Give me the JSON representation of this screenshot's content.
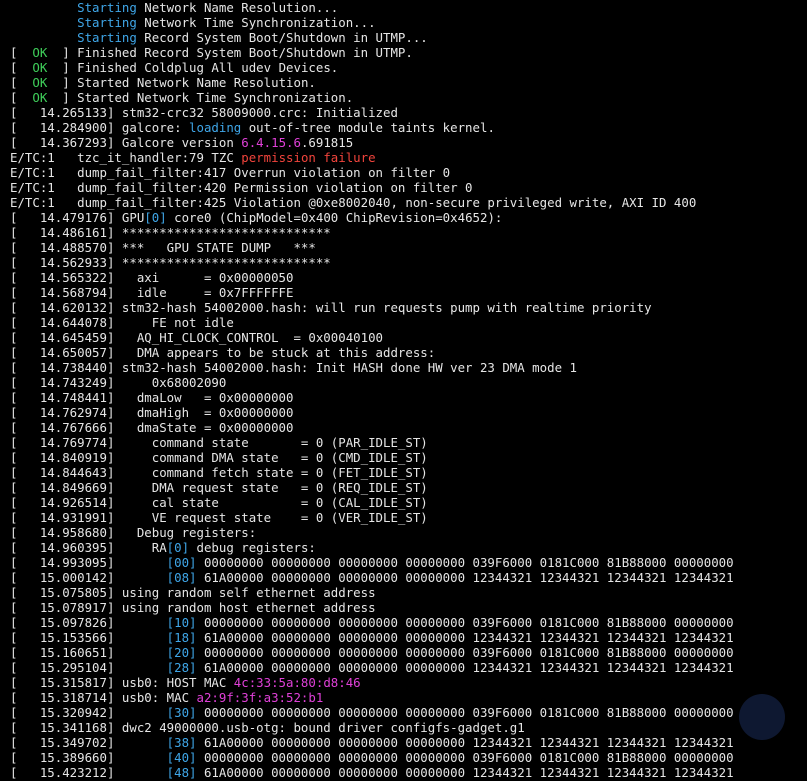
{
  "colors": {
    "background": "#000000",
    "default": "#e6e6e6",
    "cyan": "#3fa6e8",
    "green": "#3fcf5a",
    "magenta": "#e040d8",
    "red": "#f2443c"
  },
  "lines": [
    [
      [
        "default",
        "         "
      ],
      [
        "cyan",
        "Starting"
      ],
      [
        "default",
        " Network Name Resolution..."
      ]
    ],
    [
      [
        "default",
        "         "
      ],
      [
        "cyan",
        "Starting"
      ],
      [
        "default",
        " Network Time Synchronization..."
      ]
    ],
    [
      [
        "default",
        "         "
      ],
      [
        "cyan",
        "Starting"
      ],
      [
        "default",
        " Record System Boot/Shutdown in UTMP..."
      ]
    ],
    [
      [
        "default",
        "[  "
      ],
      [
        "green",
        "OK"
      ],
      [
        "default",
        "  ] Finished Record System Boot/Shutdown in UTMP."
      ]
    ],
    [
      [
        "default",
        "[  "
      ],
      [
        "green",
        "OK"
      ],
      [
        "default",
        "  ] Finished Coldplug All udev Devices."
      ]
    ],
    [
      [
        "default",
        "[  "
      ],
      [
        "green",
        "OK"
      ],
      [
        "default",
        "  ] Started Network Name Resolution."
      ]
    ],
    [
      [
        "default",
        "[  "
      ],
      [
        "green",
        "OK"
      ],
      [
        "default",
        "  ] Started Network Time Synchronization."
      ]
    ],
    [
      [
        "default",
        "[   14.265133] stm32-crc32 58009000.crc: Initialized"
      ]
    ],
    [
      [
        "default",
        "[   14.284900] galcore: "
      ],
      [
        "cyan",
        "loading"
      ],
      [
        "default",
        " out-of-tree module taints kernel."
      ]
    ],
    [
      [
        "default",
        "[   14.367293] Galcore version "
      ],
      [
        "magenta",
        "6.4.15.6"
      ],
      [
        "default",
        ".691815"
      ]
    ],
    [
      [
        "default",
        "E/TC:1   tzc_it_handler:79 TZC "
      ],
      [
        "red",
        "permission failure"
      ]
    ],
    [
      [
        "default",
        "E/TC:1   dump_fail_filter:417 Overrun violation on filter 0"
      ]
    ],
    [
      [
        "default",
        "E/TC:1   dump_fail_filter:420 Permission violation on filter 0"
      ]
    ],
    [
      [
        "default",
        "E/TC:1   dump_fail_filter:425 Violation @0xe8002040, non-secure privileged write, AXI ID 400"
      ]
    ],
    [
      [
        "default",
        "[   14.479176] GPU"
      ],
      [
        "cyan",
        "[0]"
      ],
      [
        "default",
        " core0 (ChipModel=0x400 ChipRevision=0x4652):"
      ]
    ],
    [
      [
        "default",
        "[   14.486161] ****************************"
      ]
    ],
    [
      [
        "default",
        "[   14.488570] ***   GPU STATE DUMP   ***"
      ]
    ],
    [
      [
        "default",
        "[   14.562933] ****************************"
      ]
    ],
    [
      [
        "default",
        "[   14.565322]   axi      = 0x00000050"
      ]
    ],
    [
      [
        "default",
        "[   14.568794]   idle     = 0x7FFFFFFE"
      ]
    ],
    [
      [
        "default",
        "[   14.620132] stm32-hash 54002000.hash: will run requests pump with realtime priority"
      ]
    ],
    [
      [
        "default",
        "[   14.644078]     FE not idle"
      ]
    ],
    [
      [
        "default",
        "[   14.645459]   AQ_HI_CLOCK_CONTROL  = 0x00040100"
      ]
    ],
    [
      [
        "default",
        "[   14.650057]   DMA appears to be stuck at this address:"
      ]
    ],
    [
      [
        "default",
        "[   14.738440] stm32-hash 54002000.hash: Init HASH done HW ver 23 DMA mode 1"
      ]
    ],
    [
      [
        "default",
        "[   14.743249]     0x68002090"
      ]
    ],
    [
      [
        "default",
        "[   14.748441]   dmaLow   = 0x00000000"
      ]
    ],
    [
      [
        "default",
        "[   14.762974]   dmaHigh  = 0x00000000"
      ]
    ],
    [
      [
        "default",
        "[   14.767666]   dmaState = 0x00000000"
      ]
    ],
    [
      [
        "default",
        "[   14.769774]     command state       = 0 (PAR_IDLE_ST)"
      ]
    ],
    [
      [
        "default",
        "[   14.840919]     command DMA state   = 0 (CMD_IDLE_ST)"
      ]
    ],
    [
      [
        "default",
        "[   14.844643]     command fetch state = 0 (FET_IDLE_ST)"
      ]
    ],
    [
      [
        "default",
        "[   14.849669]     DMA request state   = 0 (REQ_IDLE_ST)"
      ]
    ],
    [
      [
        "default",
        "[   14.926514]     cal state           = 0 (CAL_IDLE_ST)"
      ]
    ],
    [
      [
        "default",
        "[   14.931991]     VE request state    = 0 (VER_IDLE_ST)"
      ]
    ],
    [
      [
        "default",
        "[   14.958680]   Debug registers:"
      ]
    ],
    [
      [
        "default",
        "[   14.960395]     RA"
      ],
      [
        "cyan",
        "[0]"
      ],
      [
        "default",
        " debug registers:"
      ]
    ],
    [
      [
        "default",
        "[   14.993095]       "
      ],
      [
        "cyan",
        "[00]"
      ],
      [
        "default",
        " 00000000 00000000 00000000 00000000 039F6000 0181C000 81B88000 00000000"
      ]
    ],
    [
      [
        "default",
        "[   15.000142]       "
      ],
      [
        "cyan",
        "[08]"
      ],
      [
        "default",
        " 61A00000 00000000 00000000 00000000 12344321 12344321 12344321 12344321"
      ]
    ],
    [
      [
        "default",
        "[   15.075805] using random self ethernet address"
      ]
    ],
    [
      [
        "default",
        "[   15.078917] using random host ethernet address"
      ]
    ],
    [
      [
        "default",
        "[   15.097826]       "
      ],
      [
        "cyan",
        "[10]"
      ],
      [
        "default",
        " 00000000 00000000 00000000 00000000 039F6000 0181C000 81B88000 00000000"
      ]
    ],
    [
      [
        "default",
        "[   15.153566]       "
      ],
      [
        "cyan",
        "[18]"
      ],
      [
        "default",
        " 61A00000 00000000 00000000 00000000 12344321 12344321 12344321 12344321"
      ]
    ],
    [
      [
        "default",
        "[   15.160651]       "
      ],
      [
        "cyan",
        "[20]"
      ],
      [
        "default",
        " 00000000 00000000 00000000 00000000 039F6000 0181C000 81B88000 00000000"
      ]
    ],
    [
      [
        "default",
        "[   15.295104]       "
      ],
      [
        "cyan",
        "[28]"
      ],
      [
        "default",
        " 61A00000 00000000 00000000 00000000 12344321 12344321 12344321 12344321"
      ]
    ],
    [
      [
        "default",
        "[   15.315817] usb0: HOST MAC "
      ],
      [
        "magenta",
        "4c:33:5a:80:d8:46"
      ]
    ],
    [
      [
        "default",
        "[   15.318714] usb0: MAC "
      ],
      [
        "magenta",
        "a2:9f:3f:a3:52:b1"
      ]
    ],
    [
      [
        "default",
        "[   15.320942]       "
      ],
      [
        "cyan",
        "[30]"
      ],
      [
        "default",
        " 00000000 00000000 00000000 00000000 039F6000 0181C000 81B88000 00000000"
      ]
    ],
    [
      [
        "default",
        "[   15.341168] dwc2 49000000.usb-otg: bound driver configfs-gadget.g1"
      ]
    ],
    [
      [
        "default",
        "[   15.349702]       "
      ],
      [
        "cyan",
        "[38]"
      ],
      [
        "default",
        " 61A00000 00000000 00000000 00000000 12344321 12344321 12344321 12344321"
      ]
    ],
    [
      [
        "default",
        "[   15.389660]       "
      ],
      [
        "cyan",
        "[40]"
      ],
      [
        "default",
        " 00000000 00000000 00000000 00000000 039F6000 0181C000 81B88000 00000000"
      ]
    ],
    [
      [
        "default",
        "[   15.423212]       "
      ],
      [
        "cyan",
        "[48]"
      ],
      [
        "default",
        " 61A00000 00000000 00000000 00000000 12344321 12344321 12344321 12344321"
      ]
    ]
  ]
}
